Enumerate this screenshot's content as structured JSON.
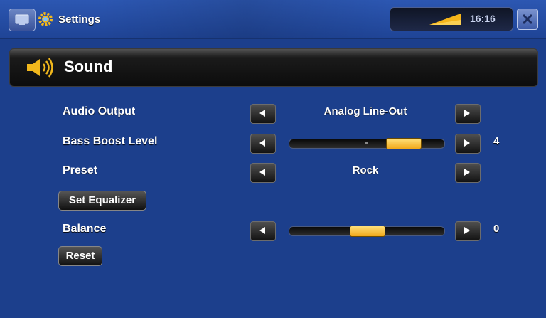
{
  "topbar": {
    "app_title": "Settings",
    "time": "16:16"
  },
  "header": {
    "section_title": "Sound"
  },
  "settings": {
    "audio_output": {
      "label": "Audio Output",
      "value": "Analog Line-Out"
    },
    "bass_boost": {
      "label": "Bass Boost Level",
      "value": "4",
      "level": 0.8
    },
    "preset": {
      "label": "Preset",
      "value": "Rock"
    },
    "set_equalizer": {
      "label": "Set Equalizer"
    },
    "balance": {
      "label": "Balance",
      "value": "0",
      "level": 0.5
    },
    "reset": {
      "label": "Reset"
    }
  },
  "colors": {
    "accent": "#f1a81a",
    "background": "#1c3f8c"
  },
  "icons": [
    "home-icon",
    "settings-gear-icon",
    "signal-strength-icon",
    "close-icon",
    "speaker-icon",
    "arrow-left-icon",
    "arrow-right-icon"
  ]
}
